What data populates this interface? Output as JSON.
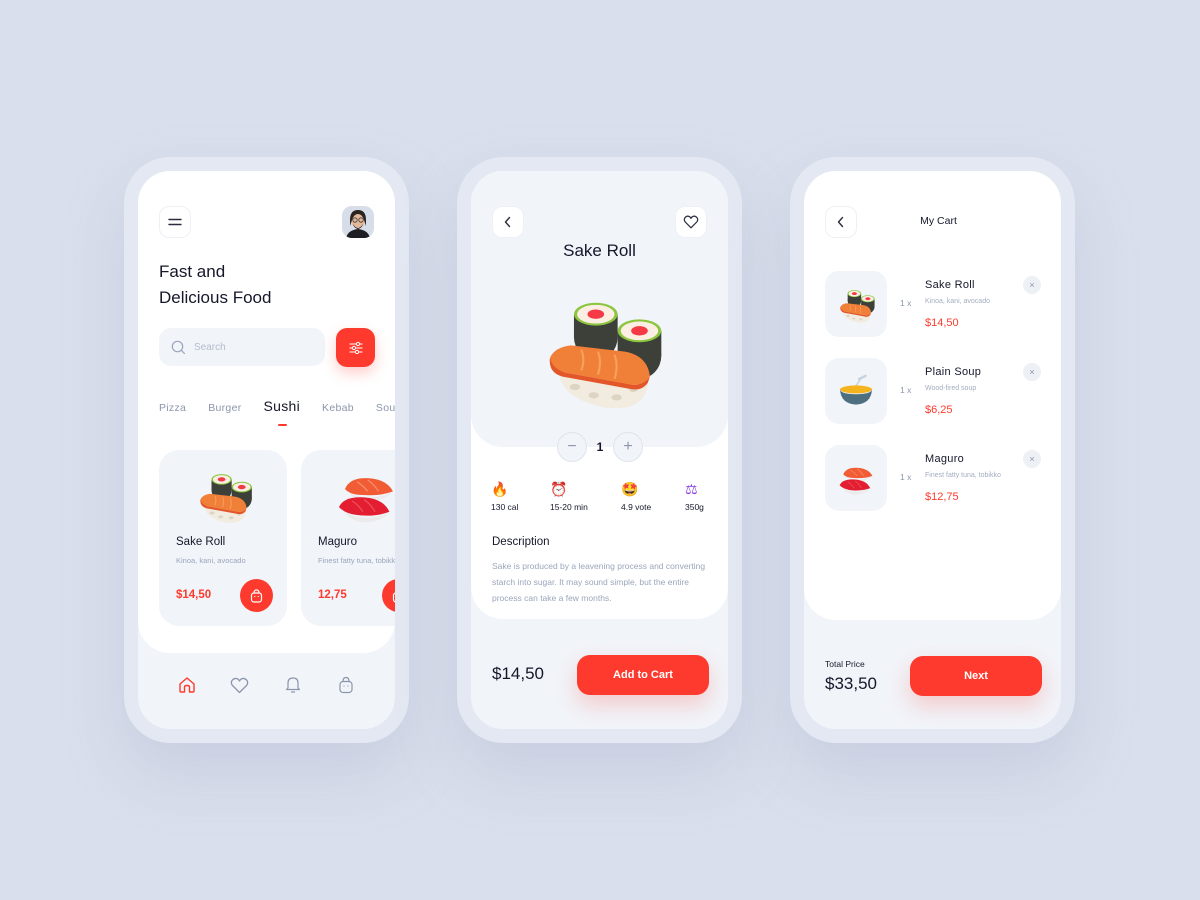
{
  "colors": {
    "accent": "#fd3a2d",
    "background": "#d9dfec",
    "text_dark": "#15172a",
    "text_muted": "#9aa6bb"
  },
  "home": {
    "menu_icon": "hamburger-menu-icon",
    "avatar_icon": "user-avatar",
    "headline_line1": "Fast and",
    "headline_line2": "Delicious Food",
    "search": {
      "placeholder": "Search",
      "value": "",
      "icon": "search-icon"
    },
    "filter_icon": "sliders-filter-icon",
    "categories": [
      {
        "label": "Pizza",
        "active": false
      },
      {
        "label": "Burger",
        "active": false
      },
      {
        "label": "Sushi",
        "active": true
      },
      {
        "label": "Kebab",
        "active": false
      },
      {
        "label": "Soup",
        "active": false
      }
    ],
    "products": [
      {
        "name": "Sake Roll",
        "desc": "Kinoa, kani, avocado",
        "price": "$14,50"
      },
      {
        "name": "Maguro",
        "desc": "Finest fatty tuna, tobikko",
        "price": "12,75"
      }
    ],
    "bottom_nav": [
      {
        "icon": "home-icon",
        "active": true
      },
      {
        "icon": "heart-icon",
        "active": false
      },
      {
        "icon": "bell-icon",
        "active": false
      },
      {
        "icon": "shopping-bag-icon",
        "active": false
      }
    ]
  },
  "detail": {
    "title": "Sake Roll",
    "quantity": "1",
    "stepper": {
      "minus": "−",
      "plus": "+"
    },
    "stats": [
      {
        "icon": "🔥",
        "icon_name": "fire-icon",
        "value": "130 cal"
      },
      {
        "icon": "⏰",
        "icon_name": "alarm-clock-icon",
        "value": "15-20 min"
      },
      {
        "icon": "🤩",
        "icon_name": "star-struck-icon",
        "value": "4.9 vote"
      },
      {
        "icon": "⚖",
        "icon_name": "scale-icon",
        "value": "350g"
      }
    ],
    "description_title": "Description",
    "description_text": "Sake is produced by a leavening process and converting starch into sugar. It may sound simple, but the entire process can take a few months.",
    "price": "$14,50",
    "add_to_cart_label": "Add to Cart"
  },
  "cart": {
    "title": "My Cart",
    "items": [
      {
        "qty": "1 x",
        "name": "Sake Roll",
        "desc": "Kinoa, kani, avocado",
        "price": "$14,50",
        "remove": "×"
      },
      {
        "qty": "1 x",
        "name": "Plain Soup",
        "desc": "Wood-fired soup",
        "price": "$6,25",
        "remove": "×"
      },
      {
        "qty": "1 x",
        "name": "Maguro",
        "desc": "Finest fatty tuna, tobikko",
        "price": "$12,75",
        "remove": "×"
      }
    ],
    "total_label": "Total Price",
    "total_value": "$33,50",
    "next_label": "Next"
  }
}
